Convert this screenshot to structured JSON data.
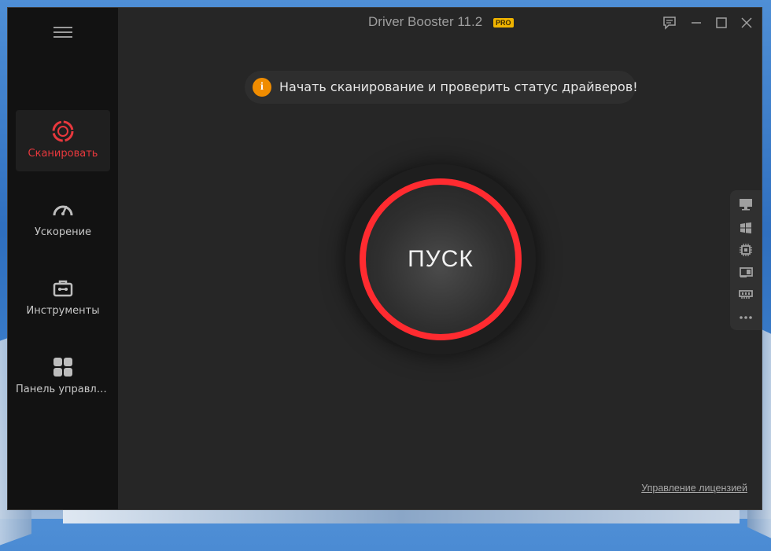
{
  "app": {
    "title": "Driver Booster 11.2",
    "badge": "PRO"
  },
  "sidebar": {
    "menu_icon": "hamburger-icon",
    "items": [
      {
        "label": "Сканировать",
        "icon": "scan-ring-icon",
        "active": true
      },
      {
        "label": "Ускорение",
        "icon": "speedometer-icon",
        "active": false
      },
      {
        "label": "Инструменты",
        "icon": "toolbox-icon",
        "active": false
      },
      {
        "label": "Панель управлен...",
        "icon": "grid-icon",
        "active": false
      }
    ]
  },
  "window_controls": {
    "feedback_icon": "chat-icon",
    "minimize_icon": "minimize-icon",
    "maximize_icon": "maximize-icon",
    "close_icon": "close-icon"
  },
  "main": {
    "notice_text": "Начать сканирование и проверить статус драйверов!",
    "notice_icon": "info-icon",
    "start_label": "ПУСК",
    "license_link": "Управление лицензией"
  },
  "right_toolbar": {
    "icons": [
      "monitor-icon",
      "windows-icon",
      "chip-icon",
      "card-icon",
      "memory-icon",
      "more-icon"
    ]
  },
  "colors": {
    "accent_red": "#ff2b30",
    "info_orange": "#f08c00",
    "pro_badge": "#f0b400",
    "background": "#262626",
    "sidebar": "#121212"
  }
}
